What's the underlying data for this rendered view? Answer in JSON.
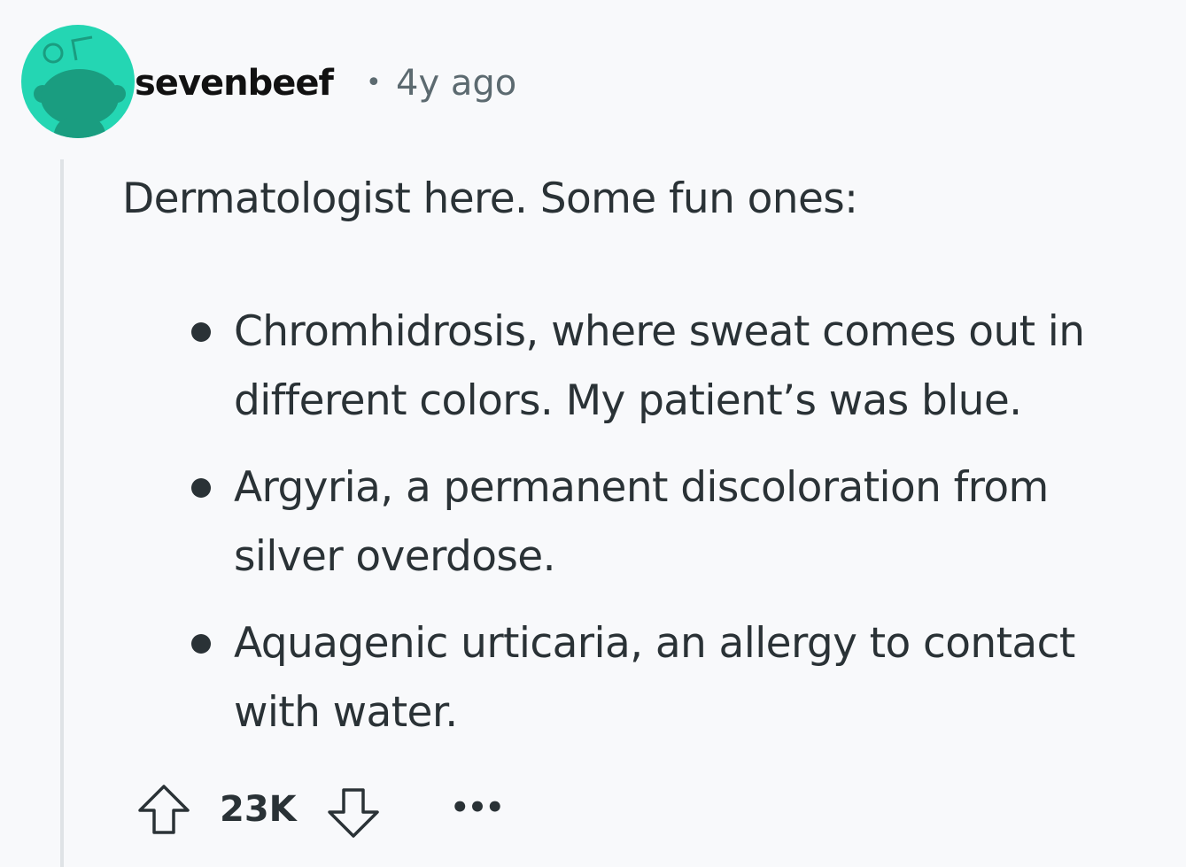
{
  "comment": {
    "author": "sevenbeef",
    "separator": "•",
    "timestamp": "4y ago",
    "intro": "Dermatologist here. Some fun ones:",
    "items": [
      {
        "text": "Chromhidrosis, where sweat comes out in different colors. My patient’s was blue."
      },
      {
        "text": "Argyria, a permanent discoloration from silver overdose."
      },
      {
        "text": "Aquagenic urticaria, an allergy to contact with water."
      }
    ],
    "score": "23K",
    "more_label": "•••"
  },
  "icons": {
    "avatar": "snoo-avatar-icon",
    "upvote": "upvote-arrow-icon",
    "downvote": "downvote-arrow-icon",
    "more": "more-options-icon"
  },
  "colors": {
    "avatar_bg": "#24d6b3",
    "avatar_figure": "#1a9d80",
    "text": "#2a3236",
    "muted": "#5c6a70",
    "background": "#f8f9fb",
    "thread_line": "#dfe3e6"
  }
}
